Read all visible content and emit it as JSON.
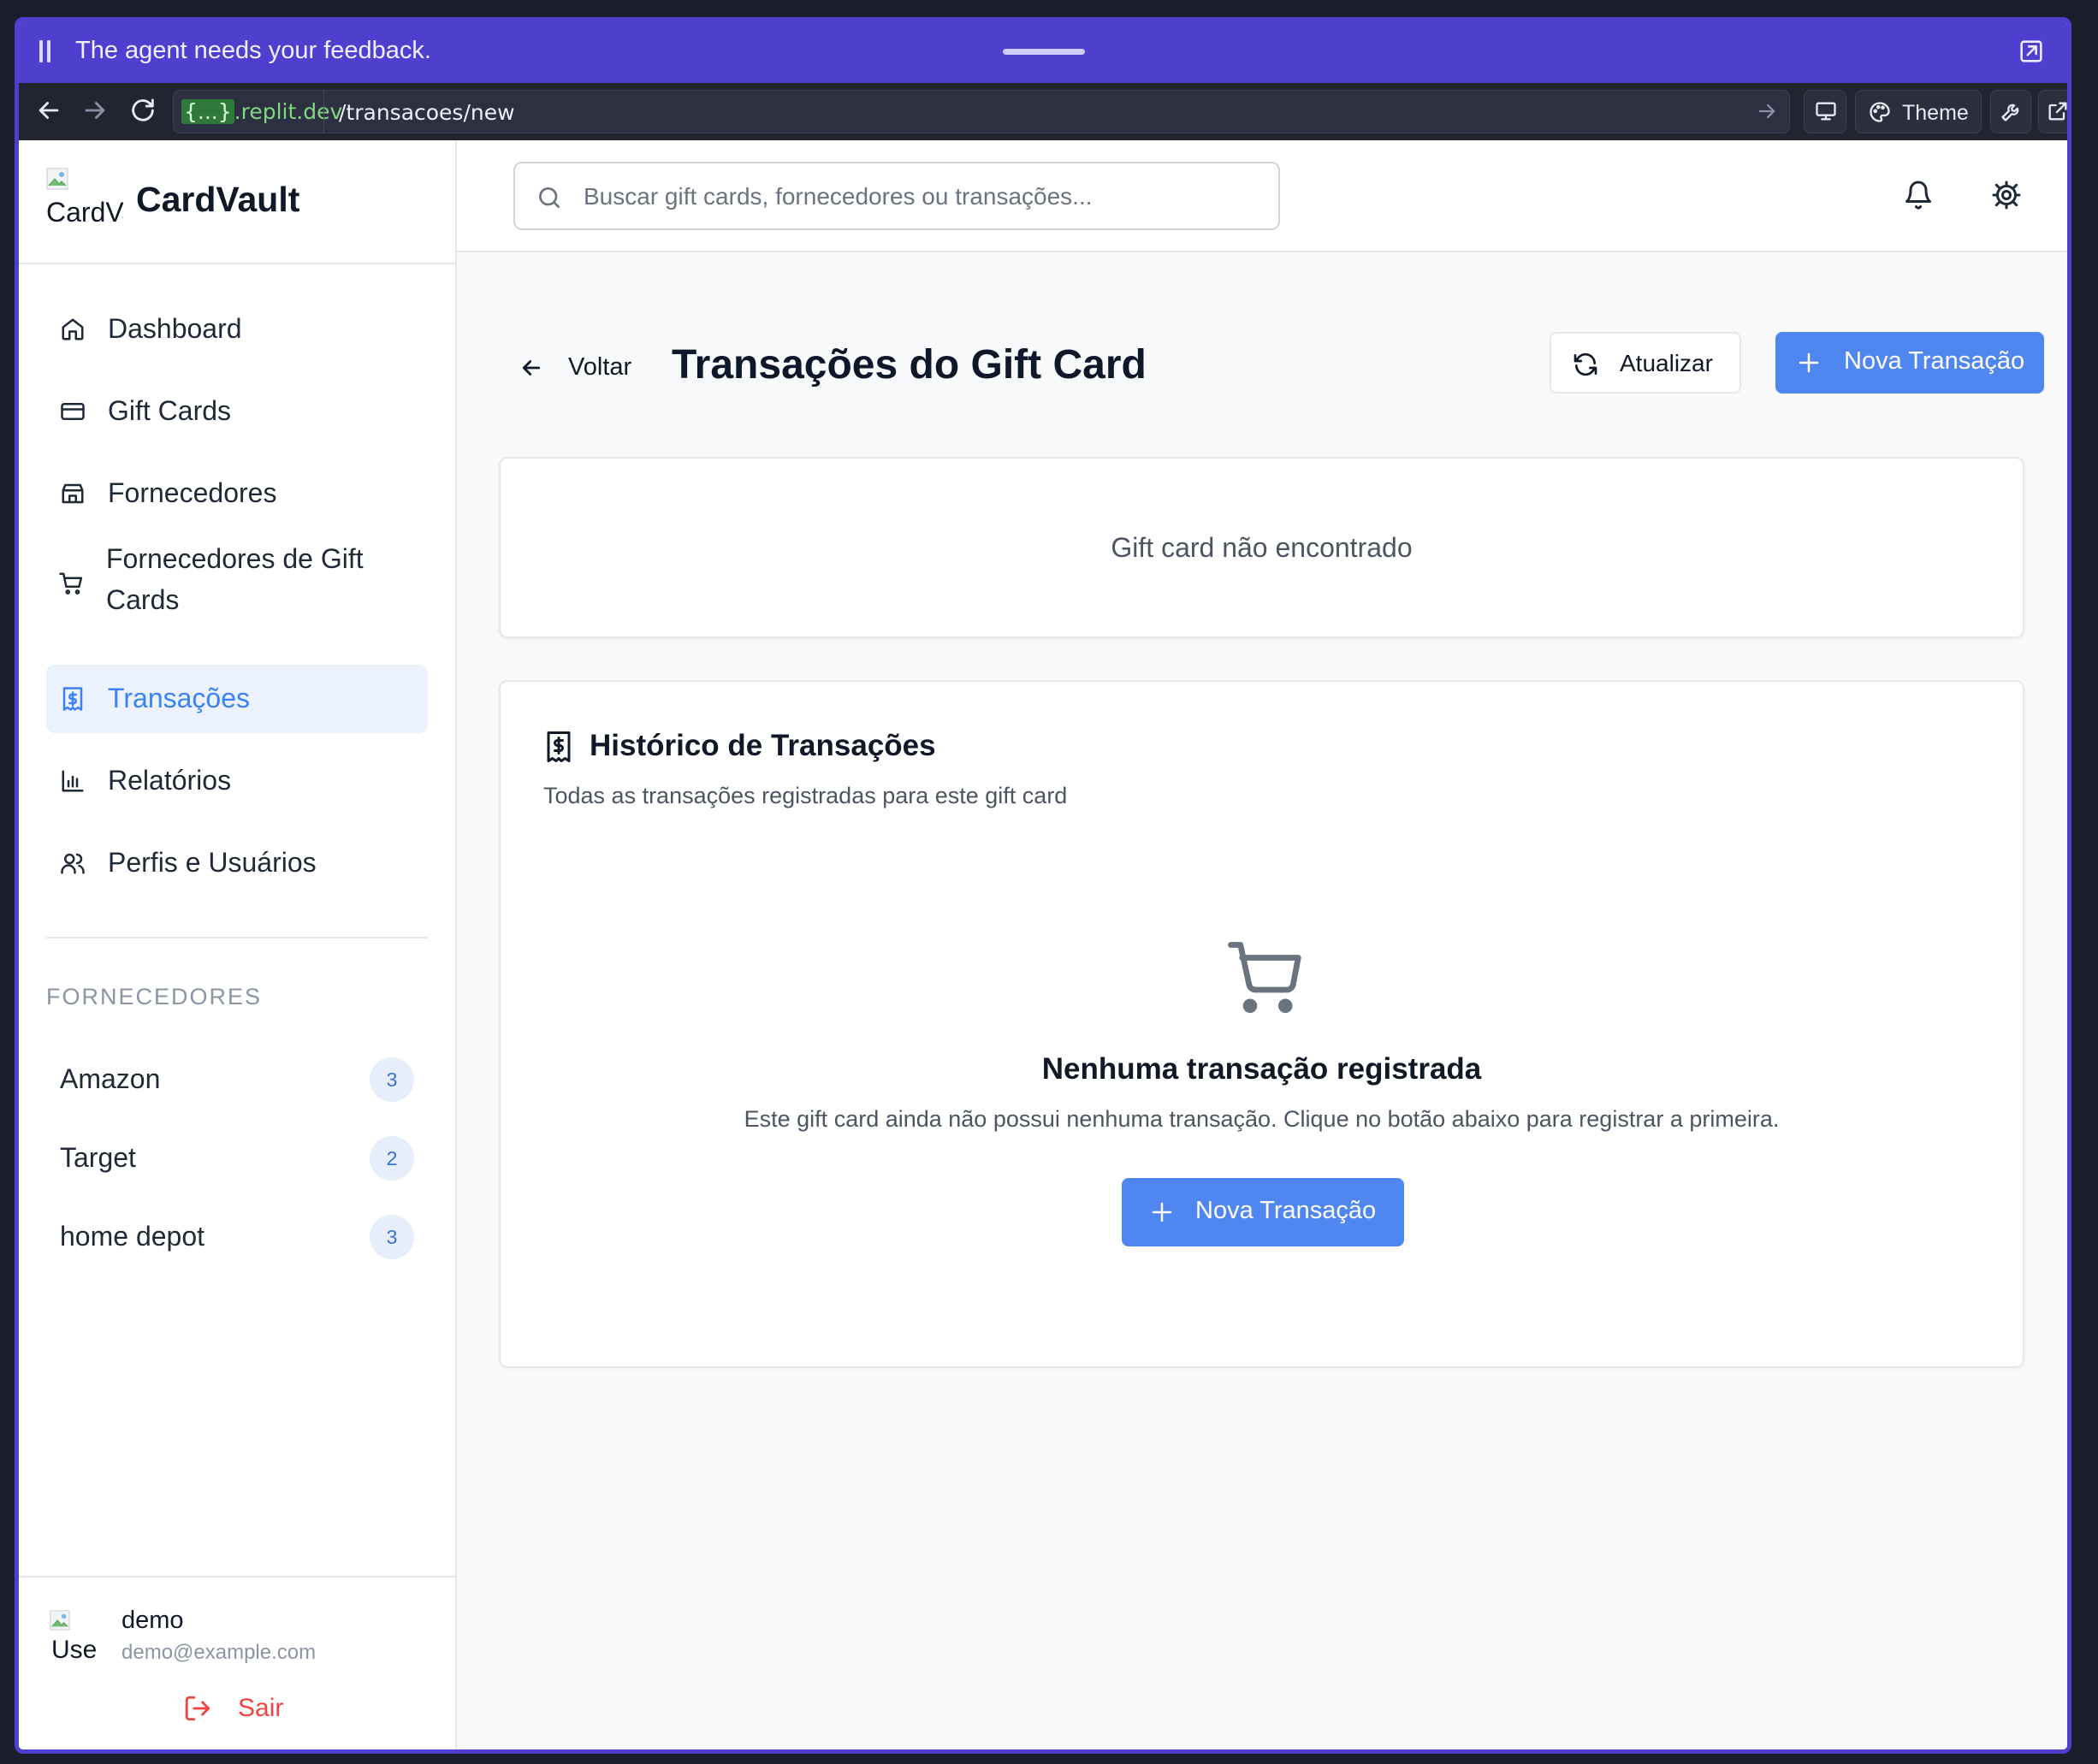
{
  "agent_bar": {
    "message": "The agent needs your feedback."
  },
  "browser": {
    "host_prefix": "{...}",
    "host_suffix": ".replit.dev",
    "path": "/transacoes/new",
    "theme_label": "Theme"
  },
  "sidebar": {
    "logo_alt": "CardVault Logo",
    "app_name": "CardVault",
    "nav": [
      {
        "label": "Dashboard",
        "icon": "home-icon"
      },
      {
        "label": "Gift Cards",
        "icon": "credit-card-icon"
      },
      {
        "label": "Fornecedores",
        "icon": "store-icon"
      },
      {
        "label": "Fornecedores de Gift Cards",
        "icon": "shopping-cart-icon"
      },
      {
        "label": "Transações",
        "icon": "receipt-icon",
        "active": true
      },
      {
        "label": "Relatórios",
        "icon": "bar-chart-icon"
      },
      {
        "label": "Perfis e Usuários",
        "icon": "users-icon"
      }
    ],
    "section_title": "FORNECEDORES",
    "vendors": [
      {
        "name": "Amazon",
        "count": "3"
      },
      {
        "name": "Target",
        "count": "2"
      },
      {
        "name": "home depot",
        "count": "3"
      }
    ],
    "user": {
      "avatar_alt": "User",
      "name": "demo",
      "email": "demo@example.com",
      "logout_label": "Sair"
    }
  },
  "topbar": {
    "search_placeholder": "Buscar gift cards, fornecedores ou transações..."
  },
  "page": {
    "back_label": "Voltar",
    "title": "Transações do Gift Card",
    "refresh_label": "Atualizar",
    "new_transaction_label": "Nova Transação",
    "not_found_message": "Gift card não encontrado",
    "history": {
      "title": "Histórico de Transações",
      "subtitle": "Todas as transações registradas para este gift card",
      "empty_title": "Nenhuma transação registrada",
      "empty_message": "Este gift card ainda não possui nenhuma transação. Clique no botão abaixo para registrar a primeira.",
      "empty_button_label": "Nova Transação"
    }
  },
  "colors": {
    "accent": "#4f86ef",
    "agent_bar": "#4f3fcf",
    "active_nav_bg": "#ebf2fd",
    "logout": "#ef4444"
  }
}
